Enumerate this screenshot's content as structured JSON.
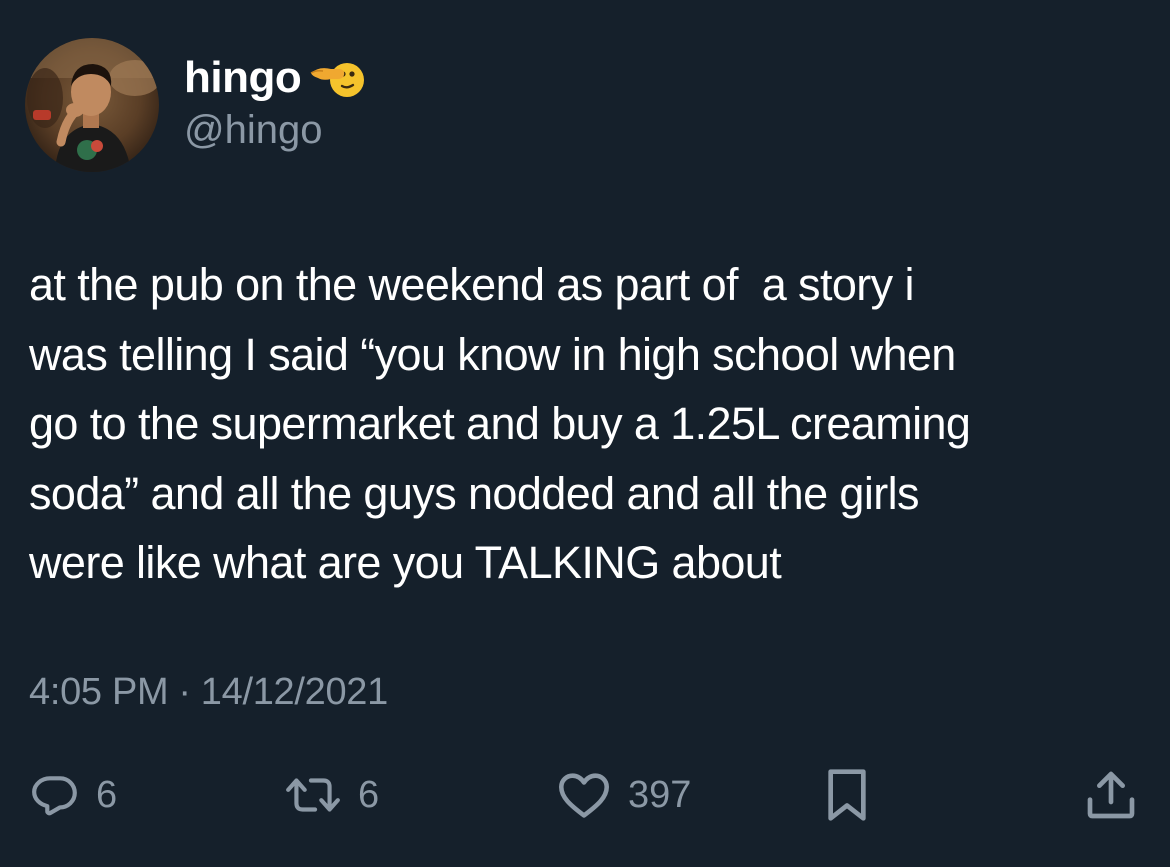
{
  "author": {
    "display_name": "hingo",
    "handle": "@hingo",
    "avatar_icon": "profile-photo",
    "name_emoji_icon": "pointing-finger-emoji"
  },
  "tweet": {
    "lines": [
      "at the pub on the weekend as part of  a story i",
      "was telling I said “you know in high school when",
      "go to the supermarket and buy a 1.25L creaming",
      "soda” and all the guys nodded and all the girls",
      "were like what are you TALKING about"
    ],
    "time": "4:05 PM",
    "separator": "·",
    "date": "14/12/2021"
  },
  "actions": {
    "reply": {
      "icon": "reply-icon",
      "count": "6"
    },
    "retweet": {
      "icon": "retweet-icon",
      "count": "6"
    },
    "like": {
      "icon": "heart-icon",
      "count": "397"
    },
    "bookmark": {
      "icon": "bookmark-icon"
    },
    "share": {
      "icon": "share-icon"
    }
  },
  "colors": {
    "background": "#15202b",
    "primary_text": "#ffffff",
    "secondary_text": "#8b98a5"
  }
}
